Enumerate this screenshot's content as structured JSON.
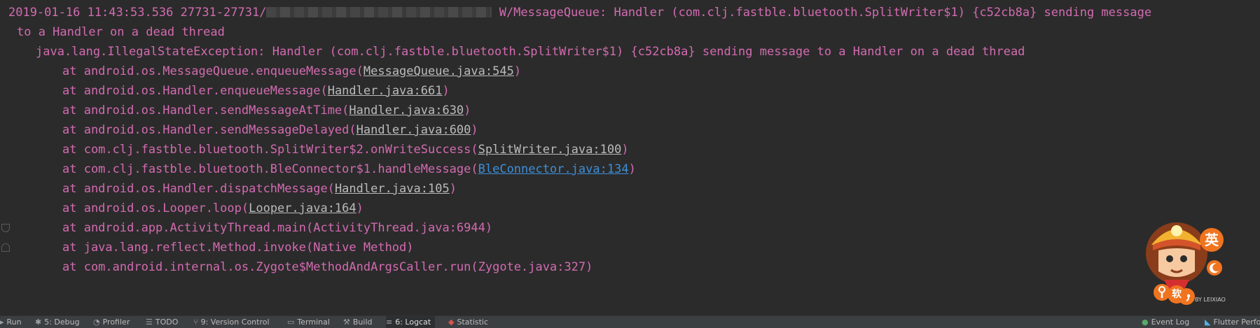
{
  "colors": {
    "background": "#2b2b2b",
    "warning_text": "#d36bb1",
    "link_text": "#bbbbbb",
    "link_blue": "#3d8fd9",
    "toolbar": "#3c3f41",
    "widget_orange": "#f0741f"
  },
  "log": {
    "line1_prefix": "2019-01-16 11:43:53.536 27731-27731/",
    "line1_suffix": " W/MessageQueue: Handler (com.clj.fastble.bluetooth.SplitWriter$1) {c52cb8a} sending message",
    "line2": "to a Handler on a dead thread",
    "exception": "java.lang.IllegalStateException: Handler (com.clj.fastble.bluetooth.SplitWriter$1) {c52cb8a} sending message to a Handler on a dead thread",
    "frames": [
      {
        "text": "at android.os.MessageQueue.enqueueMessage(",
        "link": "MessageQueue.java:545",
        "tail": ")"
      },
      {
        "text": "at android.os.Handler.enqueueMessage(",
        "link": "Handler.java:661",
        "tail": ")"
      },
      {
        "text": "at android.os.Handler.sendMessageAtTime(",
        "link": "Handler.java:630",
        "tail": ")"
      },
      {
        "text": "at android.os.Handler.sendMessageDelayed(",
        "link": "Handler.java:600",
        "tail": ")"
      },
      {
        "text": "at com.clj.fastble.bluetooth.SplitWriter$2.onWriteSuccess(",
        "link": "SplitWriter.java:100",
        "tail": ")"
      },
      {
        "text": "at com.clj.fastble.bluetooth.BleConnector$1.handleMessage(",
        "link": "BleConnector.java:134",
        "tail": ")"
      },
      {
        "text": "at android.os.Handler.dispatchMessage(",
        "link": "Handler.java:105",
        "tail": ")"
      },
      {
        "text": "at android.os.Looper.loop(",
        "link": "Looper.java:164",
        "tail": ")"
      },
      {
        "text": "at android.app.ActivityThread.main(ActivityThread.java:6944)"
      },
      {
        "text": "at java.lang.reflect.Method.invoke(Native Method)"
      },
      {
        "text": "at com.android.internal.os.Zygote$MethodAndArgsCaller.run(Zygote.java:327)"
      }
    ]
  },
  "toolbar": {
    "run": "Run",
    "debug": "5: Debug",
    "profiler": "Profiler",
    "todo": "TODO",
    "version_control": "9: Version Control",
    "terminal": "Terminal",
    "build": "Build",
    "logcat": "6: Logcat",
    "statistic": "Statistic",
    "event_log": "Event Log",
    "flutter_perf": "Flutter Perfo"
  },
  "widget": {
    "lang_label": "英",
    "soft_label": "软",
    "brand": "BY LEIXIAO"
  }
}
